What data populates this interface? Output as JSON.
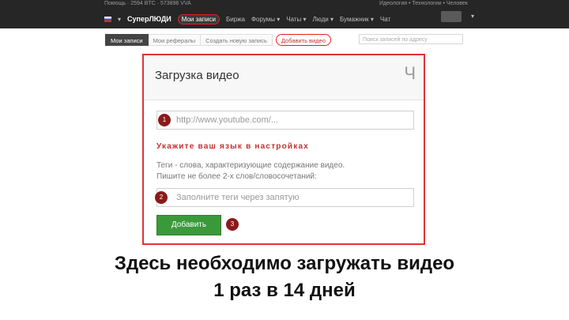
{
  "topbar": {
    "left_text": "Помощь · 2594 BTC · 573896 VVA",
    "right_text": "Идеология • Технологии • Человек",
    "brand": "СуперЛЮДИ",
    "nav": [
      {
        "label": "Мои записи",
        "active": true
      },
      {
        "label": "Биржа",
        "active": false
      },
      {
        "label": "Форумы ▾",
        "active": false
      },
      {
        "label": "Чаты ▾",
        "active": false
      },
      {
        "label": "Люди ▾",
        "active": false
      },
      {
        "label": "Бумажник ▾",
        "active": false
      },
      {
        "label": "Чат",
        "active": false
      }
    ],
    "menu_caret": "▾"
  },
  "subtabs": [
    {
      "label": "Мои записи"
    },
    {
      "label": "Мои рефералы"
    },
    {
      "label": "Создать новую запись"
    },
    {
      "label": "Добавить видео"
    }
  ],
  "search": {
    "placeholder": "Поиск записей по адресу"
  },
  "modal": {
    "title": "Загрузка видео",
    "close_glyph": "Ч",
    "url_placeholder": "http://www.youtube.com/...",
    "warning": "Укажите ваш язык в настройках",
    "desc_line1": "Теги - слова, характеризующие содержание видео.",
    "desc_line2": "Пишите не более 2-х слов/словосочетаний:",
    "tags_placeholder": "Заполните теги через запятую",
    "add_button": "Добавить",
    "badges": [
      "1",
      "2",
      "3"
    ]
  },
  "caption": {
    "line1": "Здесь необходимо загружать видео",
    "line2": "1 раз в 14 дней"
  },
  "colors": {
    "highlight": "#e33232",
    "button": "#3a9a3a",
    "badge": "#8b1a1a",
    "topbar": "#262626"
  }
}
